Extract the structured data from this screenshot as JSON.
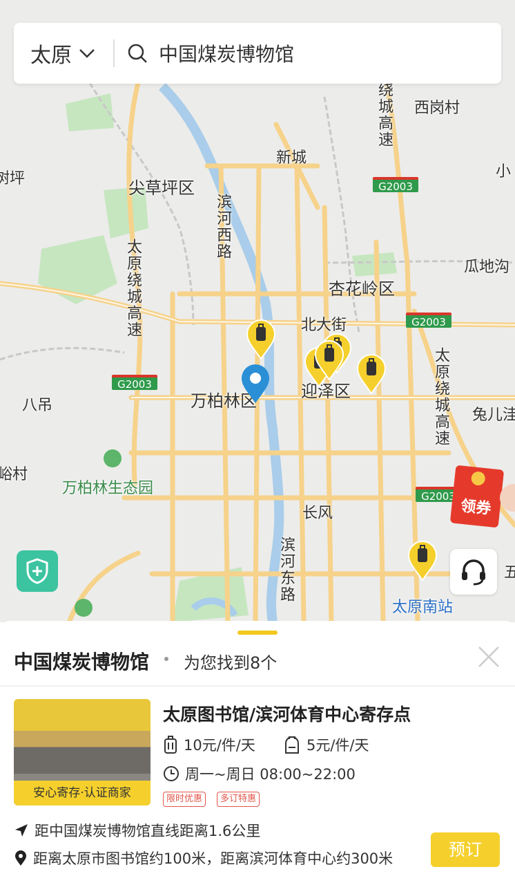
{
  "search": {
    "city": "太原",
    "query": "中国煤炭博物馆"
  },
  "map": {
    "labels": {
      "xigang": "西岗村",
      "xincheng": "新城",
      "xiao": "小",
      "shuping": "树坪",
      "jiancaoping": "尖草坪区",
      "binhexilu": "滨河西路",
      "xinghualing": "杏花岭区",
      "guadigou": "瓜地沟",
      "beidajie": "北大街",
      "wanbailin": "万柏林区",
      "yingze": "迎泽区",
      "badiao": "八吊",
      "tuerjian": "兔儿洼",
      "yucun": "峪村",
      "shengtaiyuan": "万柏林生态园",
      "changfeng": "长风",
      "binhedonglu": "滨河东路",
      "wu": "五",
      "nanzhan": "太原南站",
      "ring_west": "太原绕城高速",
      "ring_north": "绕城高速",
      "ring_east": "太原绕城高速"
    },
    "highway_shield": "G2003",
    "coupon": "领券"
  },
  "panel": {
    "title": "中国煤炭博物馆",
    "found": "为您找到8个",
    "item": {
      "name": "太原图书馆/滨河体育中心寄存点",
      "thumb_tag": "安心寄存·认证商家",
      "price_luggage": "10元/件/天",
      "price_bag": "5元/件/天",
      "hours": "周一~周日 08:00~22:00",
      "badges": [
        "限时优惠",
        "多订特惠"
      ],
      "distance": "距中国煤炭博物馆直线距离1.6公里",
      "location": "距离太原市图书馆约100米，距离滨河体育中心约300米",
      "book": "预订"
    }
  },
  "colors": {
    "accent": "#f5d02c",
    "pin_blue": "#2b8fd6",
    "badge_red": "#e2554a"
  }
}
